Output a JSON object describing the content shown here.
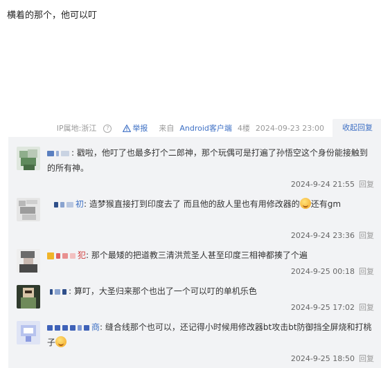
{
  "post": {
    "content": "横着的那个，他可以叮"
  },
  "footer": {
    "ip_location": "IP属地:浙江",
    "ip_help": "?",
    "report_label": "举报",
    "source": "来自",
    "client": "Android客户端",
    "floor": "4楼",
    "datetime": "2024-09-23 23:00",
    "collapse_reply": "收起回复"
  },
  "replies": [
    {
      "username_suffix": "",
      "text": "戳啦，他叮了也最多打个二郎神，那个玩偶可是打遍了孙悟空这个身份能接触到的所有神。",
      "time": "2024-9-24 21:55",
      "reply_label": "回复"
    },
    {
      "username_suffix": "初",
      "text": "造梦猴直接打到印度去了 而且他的敌人里也有用修改器的",
      "text_after_emoji": "还有gm",
      "time": "2024-9-24 23:36",
      "reply_label": "回复"
    },
    {
      "username_suffix": "犯",
      "text": "那个最矮的把道教三清洪荒圣人甚至印度三相神都揍了个遍",
      "time": "2024-9-25 00:18",
      "reply_label": "回复"
    },
    {
      "username_suffix": "",
      "text": "算叮，大圣归来那个也出了一个可以叮的单机乐色",
      "time": "2024-9-25 17:02",
      "reply_label": "回复"
    },
    {
      "username_suffix": "商",
      "text": "缝合线那个也可以，还记得小时候用修改器bt攻击bt防御挡全屏烧和打桃子",
      "time": "2024-9-25 18:50",
      "reply_label": "回复"
    }
  ],
  "colors": {
    "link": "#3c6fc4",
    "reply_bg": "#f2f3f5",
    "meta": "#999999"
  }
}
